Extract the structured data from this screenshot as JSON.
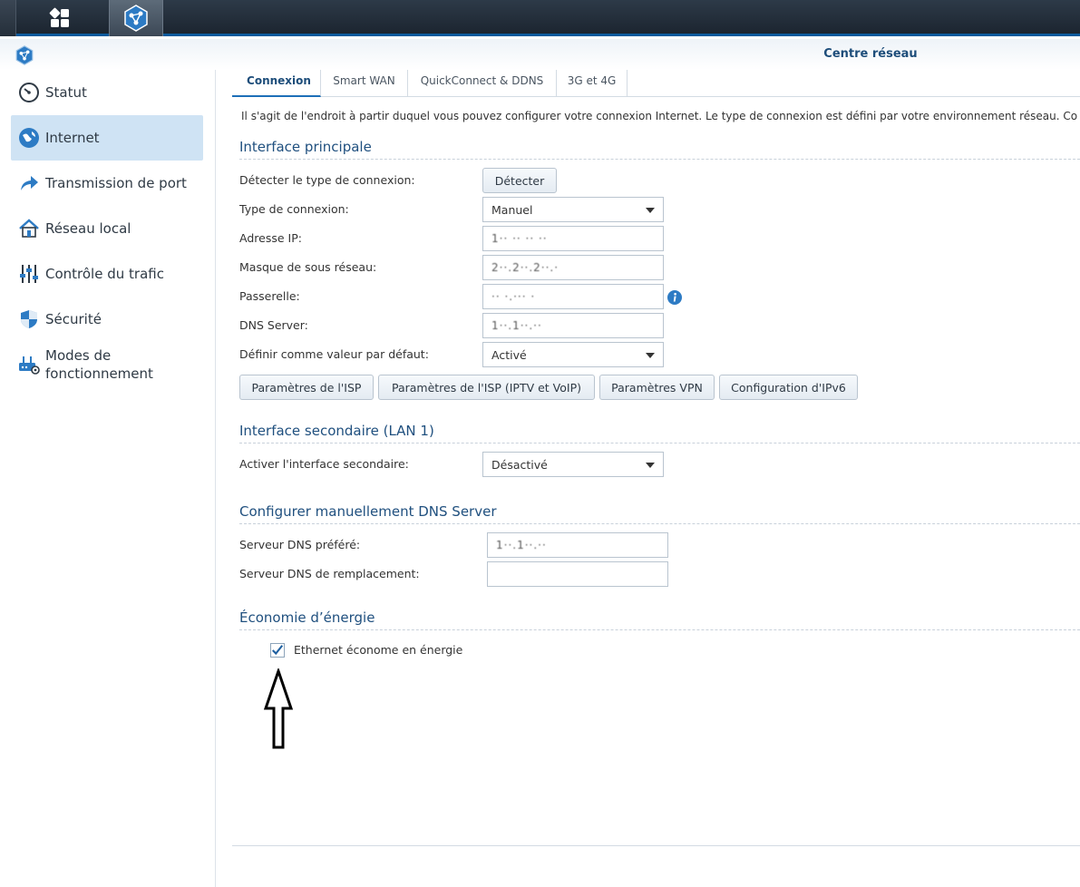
{
  "window": {
    "title": "Centre réseau"
  },
  "taskbar": {
    "main_menu_icon": "grid-icon",
    "app_icon": "network-center-icon"
  },
  "sidebar": {
    "items": [
      {
        "label": "Statut",
        "icon": "gauge-icon",
        "active": false
      },
      {
        "label": "Internet",
        "icon": "globe-icon",
        "active": true
      },
      {
        "label": "Transmission de port",
        "icon": "forward-arrow-icon",
        "active": false
      },
      {
        "label": "Réseau local",
        "icon": "house-icon",
        "active": false
      },
      {
        "label": "Contrôle du trafic",
        "icon": "sliders-icon",
        "active": false
      },
      {
        "label": "Sécurité",
        "icon": "shield-icon",
        "active": false
      },
      {
        "label": "Modes de fonctionnement",
        "icon": "router-gear-icon",
        "active": false
      }
    ]
  },
  "tabs": [
    {
      "label": "Connexion",
      "active": true
    },
    {
      "label": "Smart WAN",
      "active": false
    },
    {
      "label": "QuickConnect & DDNS",
      "active": false
    },
    {
      "label": "3G et 4G",
      "active": false
    }
  ],
  "description": "Il s'agit de l'endroit à partir duquel vous pouvez configurer votre connexion Internet. Le type de connexion est défini par votre environnement réseau. Co",
  "primary": {
    "title": "Interface principale",
    "detect_label": "Détecter le type de connexion:",
    "detect_button": "Détecter",
    "conn_type_label": "Type de connexion:",
    "conn_type_value": "Manuel",
    "ip_label": "Adresse IP:",
    "ip_value": "1·· ·· ·· ··",
    "mask_label": "Masque de sous réseau:",
    "mask_value": "2··.2··.2··.·",
    "gateway_label": "Passerelle:",
    "gateway_value": "·· ·.··· ·",
    "dns_label": "DNS Server:",
    "dns_value": "1··.1··.··",
    "default_label": "Définir comme valeur par défaut:",
    "default_value": "Activé",
    "buttons": {
      "isp": "Paramètres de l'ISP",
      "isp_iptv": "Paramètres de l'ISP (IPTV et VoIP)",
      "vpn": "Paramètres VPN",
      "ipv6": "Configuration d'IPv6"
    }
  },
  "secondary": {
    "title": "Interface secondaire (LAN 1)",
    "enable_label": "Activer l'interface secondaire:",
    "enable_value": "Désactivé"
  },
  "manual_dns": {
    "title": "Configurer manuellement DNS Server",
    "preferred_label": "Serveur DNS préféré:",
    "preferred_value": "1··.1··.··",
    "alternate_label": "Serveur DNS de remplacement:",
    "alternate_value": ""
  },
  "energy": {
    "title": "Économie d’énergie",
    "ethernet_label": "Ethernet économe en énergie",
    "ethernet_checked": true
  },
  "colors": {
    "accent": "#1d6fb8",
    "active_bg": "#cfe3f4",
    "title_blue": "#20507f"
  }
}
